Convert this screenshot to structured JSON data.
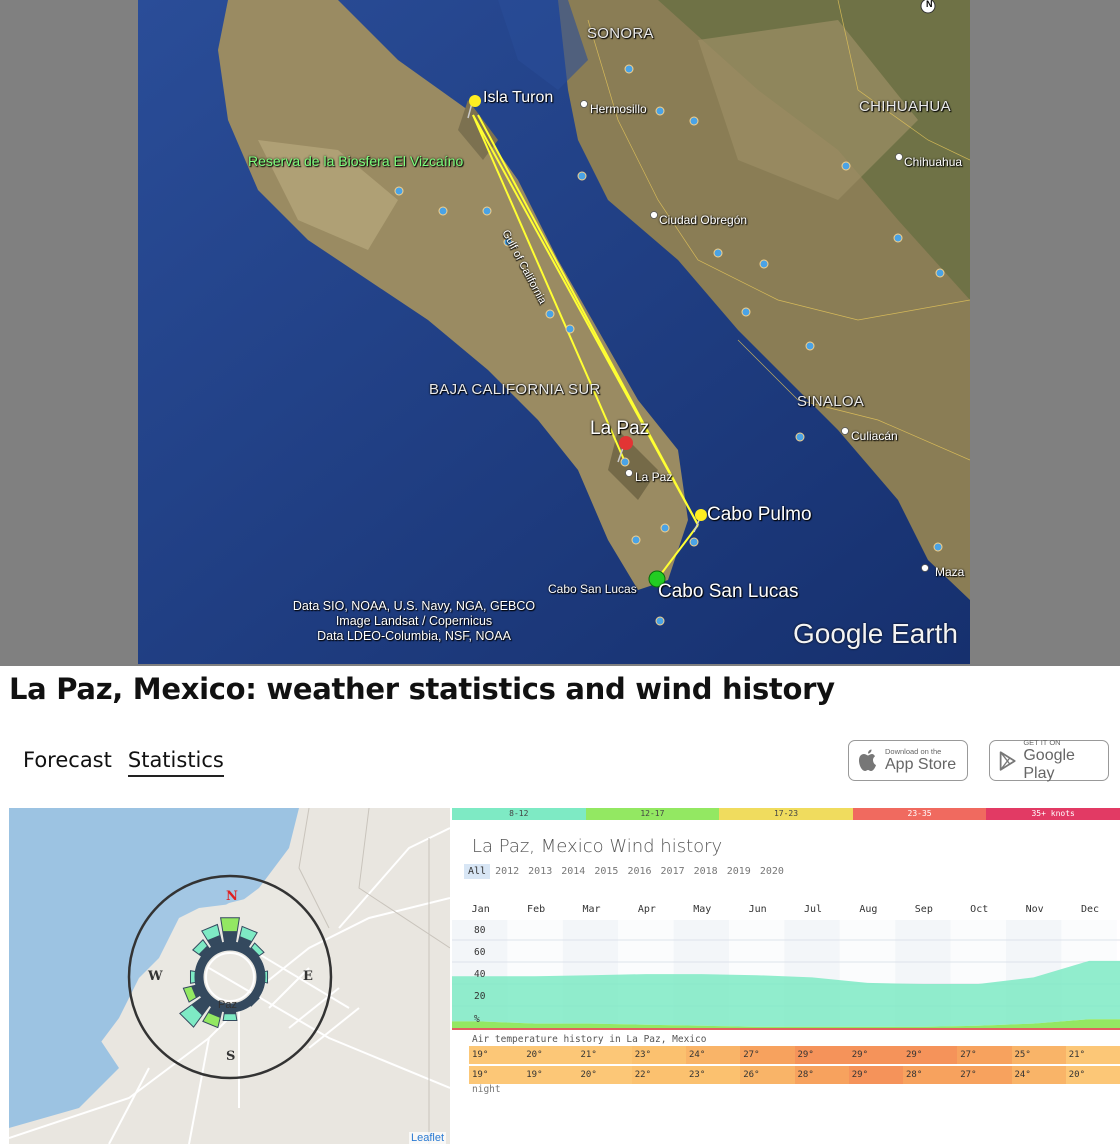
{
  "earth": {
    "regions": {
      "sonora": "SONORA",
      "chihuahua": "CHIHUAHUA",
      "bcs": "BAJA CALIFORNIA SUR",
      "sinaloa": "SINALOA"
    },
    "cities": {
      "hermosillo": "Hermosillo",
      "chihuahua": "Chihuahua",
      "obregon": "Ciudad Obregón",
      "culiacan": "Culiacán",
      "lapaz": "La Paz",
      "cabo_city": "Cabo San Lucas",
      "maza": "Maza"
    },
    "placemarks": {
      "isla_turon": "Isla Turon",
      "la_paz": "La Paz",
      "cabo_pulmo": "Cabo Pulmo",
      "cabo_san_lucas": "Cabo San Lucas"
    },
    "reserve": "Reserva de la Biosfera El Vizcaíno",
    "gulf": "Gulf of California",
    "north": "N",
    "credits": [
      "Data SIO, NOAA, U.S. Navy, NGA, GEBCO",
      "Image Landsat / Copernicus",
      "Data LDEO-Columbia, NSF, NOAA"
    ],
    "logo": "Google Earth"
  },
  "page": {
    "title": "La Paz, Mexico: weather statistics and wind history",
    "tabs": [
      "Forecast",
      "Statistics"
    ],
    "active_tab": "Statistics",
    "app_store": {
      "small": "Download on the",
      "big": "App Store"
    },
    "google_play": {
      "small": "GET IT ON",
      "big": "Google Play"
    }
  },
  "map": {
    "compass": {
      "n": "N",
      "e": "E",
      "s": "S",
      "w": "W"
    },
    "town": "Paz",
    "attribution": "Leaflet"
  },
  "wind": {
    "legend": [
      {
        "label": "8-12",
        "color": "#7eeac4"
      },
      {
        "label": "12-17",
        "color": "#93e862"
      },
      {
        "label": "17-23",
        "color": "#f0dc5e"
      },
      {
        "label": "23-35",
        "color": "#f06a5f"
      },
      {
        "label": "35+ knots",
        "color": "#e23a64"
      }
    ],
    "title": "La Paz, Mexico Wind history",
    "years": [
      "All",
      "2012",
      "2013",
      "2014",
      "2015",
      "2016",
      "2017",
      "2018",
      "2019",
      "2020"
    ],
    "active_year": "All",
    "months": [
      "Jan",
      "Feb",
      "Mar",
      "Apr",
      "May",
      "Jun",
      "Jul",
      "Aug",
      "Sep",
      "Oct",
      "Nov",
      "Dec"
    ],
    "y_ticks": [
      "80",
      "60",
      "40",
      "20",
      "%"
    ],
    "air_label": "Air temperature history in La Paz, Mexico",
    "day_temps": [
      "19°",
      "20°",
      "21°",
      "23°",
      "24°",
      "27°",
      "29°",
      "29°",
      "29°",
      "27°",
      "25°",
      "21°"
    ],
    "night_temps": [
      "19°",
      "19°",
      "20°",
      "22°",
      "23°",
      "26°",
      "28°",
      "29°",
      "28°",
      "27°",
      "24°",
      "20°"
    ],
    "night_label": "night"
  },
  "chart_data": {
    "type": "area",
    "categories": [
      "Jan",
      "Feb",
      "Mar",
      "Apr",
      "May",
      "Jun",
      "Jul",
      "Aug",
      "Sep",
      "Oct",
      "Nov",
      "Dec"
    ],
    "series": [
      {
        "name": "12-17",
        "values": [
          6,
          4,
          4,
          3,
          2,
          1,
          1,
          1,
          1,
          2,
          4,
          8
        ]
      },
      {
        "name": "8-12",
        "values": [
          41,
          43,
          44,
          46,
          47,
          47,
          45,
          40,
          39,
          38,
          42,
          53
        ]
      }
    ],
    "ylim": [
      0,
      100
    ]
  }
}
